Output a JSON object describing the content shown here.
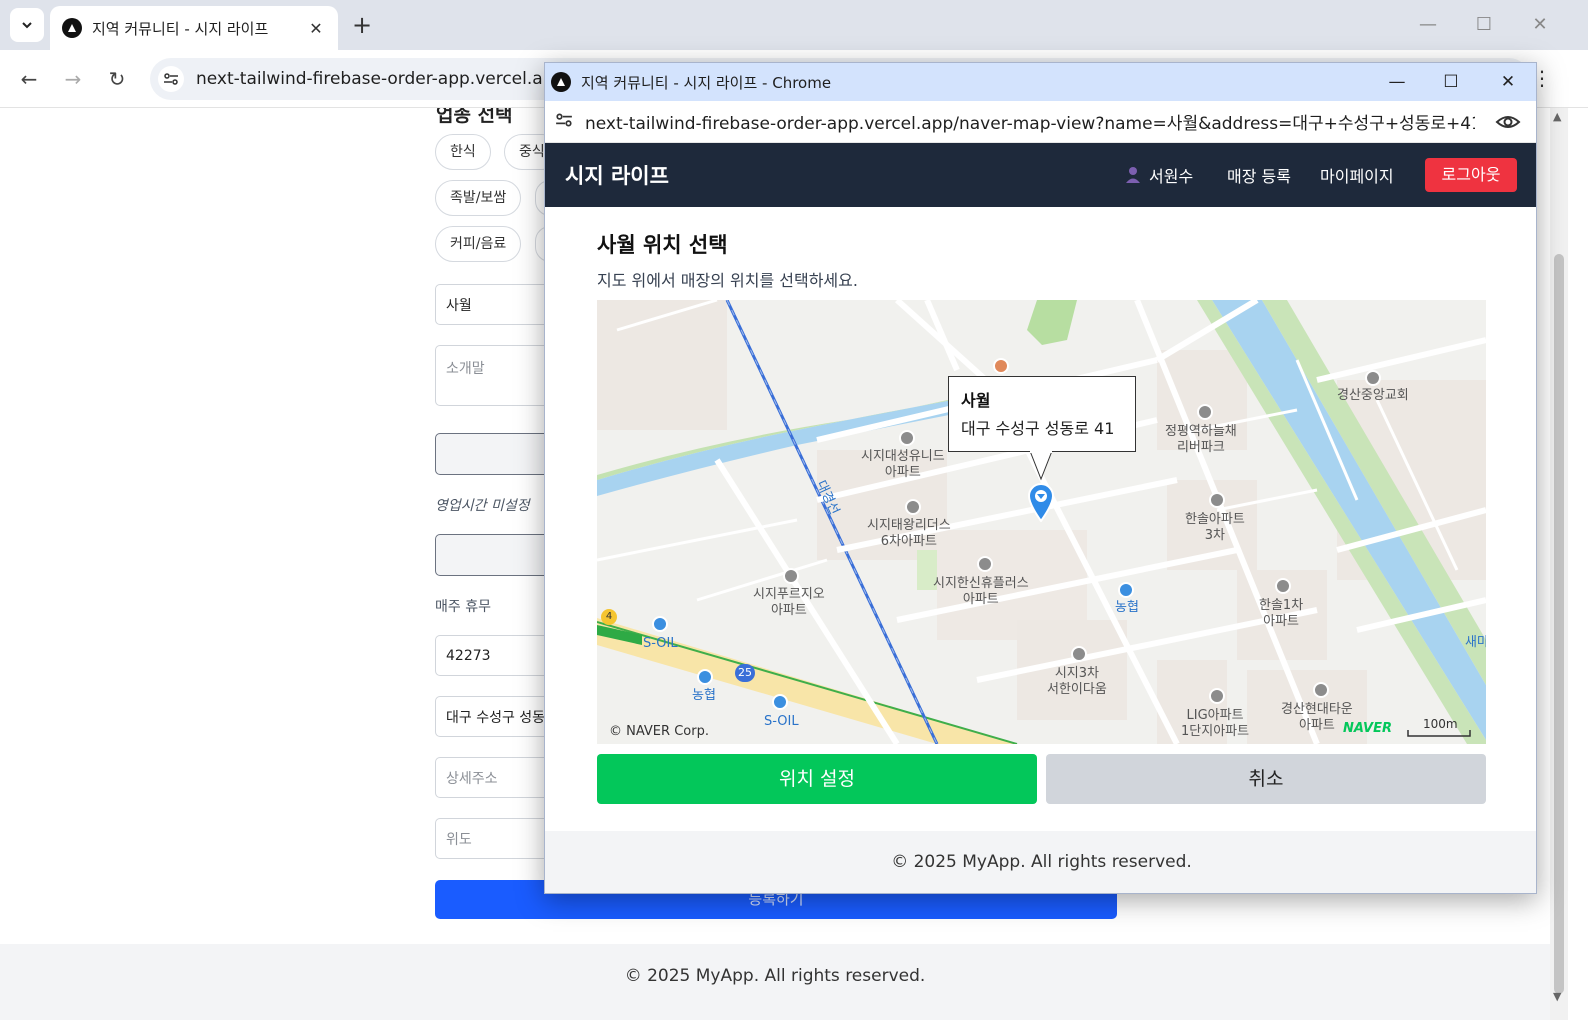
{
  "browser": {
    "tab_title": "지역 커뮤니티 - 시지 라이프",
    "url": "next-tailwind-firebase-order-app.vercel.app/s"
  },
  "background_page": {
    "section_title": "업종 선택",
    "categories": [
      "한식",
      "중식",
      "족발/보쌈",
      "커피/음료"
    ],
    "store_name_value": "사월",
    "intro_placeholder": "소개말",
    "hours_status": "영업시간 미설정",
    "weekly_off_label": "매주 휴무",
    "zipcode_value": "42273",
    "address_value": "대구 수성구 성동",
    "detail_address_placeholder": "상세주소",
    "latitude_placeholder": "위도",
    "submit_label": "등록하기",
    "footer": "© 2025 MyApp. All rights reserved."
  },
  "popup": {
    "window_title": "지역 커뮤니티 - 시지 라이프 - Chrome",
    "url": "next-tailwind-firebase-order-app.vercel.app/naver-map-view?name=사월&address=대구+수성구+성동로+41&la...",
    "nav": {
      "brand": "시지 라이프",
      "user_name": "서원수",
      "store_register": "매장 등록",
      "mypage": "마이페이지",
      "logout": "로그아웃"
    },
    "heading": "사월 위치 선택",
    "subheading": "지도 위에서 매장의 위치를 선택하세요.",
    "map": {
      "marker_name": "사월",
      "marker_address": "대구 수성구 성동로 41",
      "copyright": "© NAVER Corp.",
      "logo": "NAVER",
      "scale": "100m",
      "labels": {
        "church": "경산중앙교회",
        "apt1": "정평역하늘채\n리버파크",
        "apt2": "시지대성유니드\n아파트",
        "apt3": "시지태왕리더스\n6차아파트",
        "apt4": "한솔아파트\n3차",
        "apt5": "시지한신휴플러스\n아파트",
        "apt6": "시지푸르지오\n아파트",
        "apt7": "한솔1차\n아파트",
        "apt8": "시지3차\n서한이다움",
        "apt9": "경산현대타운\n아파트",
        "apt10": "LIG아파트\n1단지아파트",
        "bank1": "농협",
        "bank2": "농협",
        "gas1": "S-OIL",
        "gas2": "S-OIL",
        "rail": "대경선",
        "route": "25",
        "route4": "4",
        "edge": "새마"
      }
    },
    "confirm": "위치 설정",
    "cancel": "취소",
    "footer": "© 2025 MyApp. All rights reserved."
  },
  "colors": {
    "nav_bg": "#1e293b",
    "logout": "#ef3340",
    "confirm": "#03c75a",
    "submit": "#1a5cff"
  }
}
